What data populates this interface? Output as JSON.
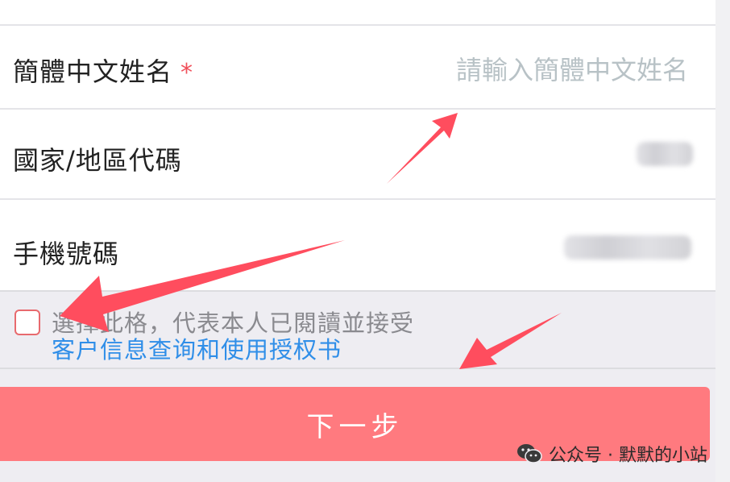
{
  "form": {
    "name_field": {
      "label": "簡體中文姓名",
      "required_mark": "*",
      "placeholder": "請輸入簡體中文姓名",
      "value": ""
    },
    "region_field": {
      "label": "國家/地區代碼"
    },
    "phone_field": {
      "label": "手機號碼"
    }
  },
  "agreement": {
    "text": "選擇此格，代表本人已閱讀並接受",
    "link_text": "客户信息查询和使用授权书",
    "checked": false
  },
  "actions": {
    "next_label": "下一步"
  },
  "watermark": {
    "text": "公众号 · 默默的小站"
  },
  "colors": {
    "accent": "#ff7a7f",
    "link": "#2f8ee8",
    "arrow": "#ff4d5e",
    "required": "#f04f5a"
  }
}
